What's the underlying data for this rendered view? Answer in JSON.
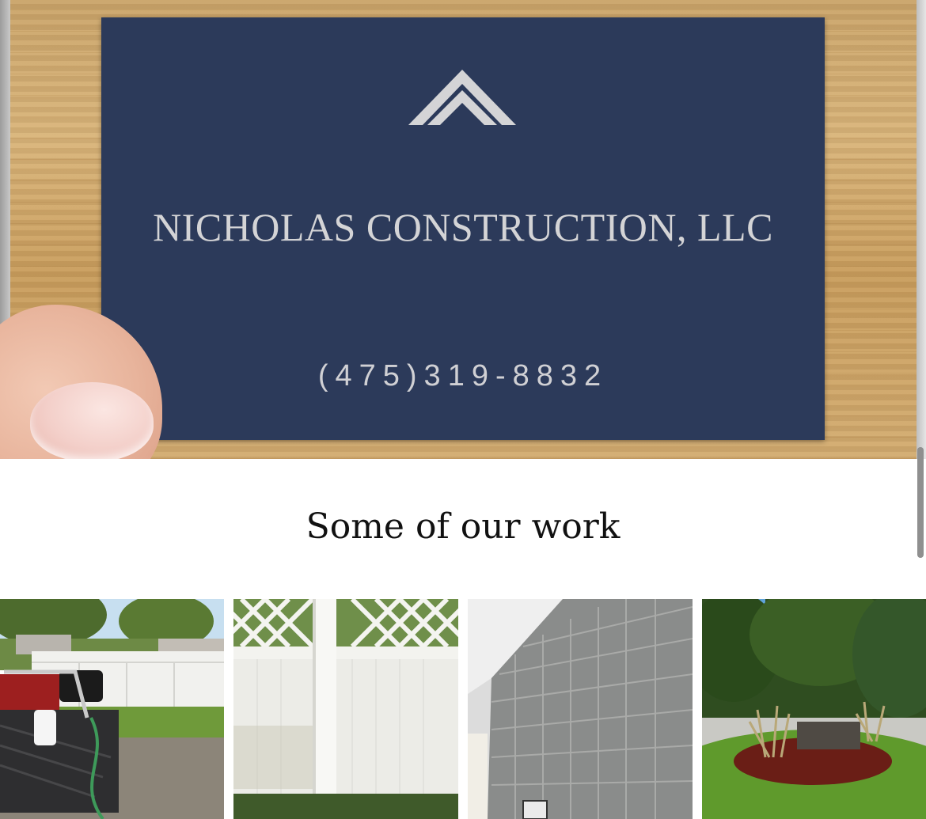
{
  "hero": {
    "company_name": "NICHOLAS CONSTRUCTION, LLC",
    "phone": "(475)319-8832",
    "logo_icon": "roof-chevron-icon"
  },
  "work_section": {
    "title": "Some of our work",
    "gallery": [
      {
        "subject": "truck-pressure-washer-photo"
      },
      {
        "subject": "white-vinyl-fence-photo"
      },
      {
        "subject": "tile-wall-photo"
      },
      {
        "subject": "landscaped-sign-bed-photo"
      }
    ]
  },
  "colors": {
    "card_navy": "#2c3a5a",
    "card_text": "#d4d4d6",
    "heading": "#111111"
  }
}
